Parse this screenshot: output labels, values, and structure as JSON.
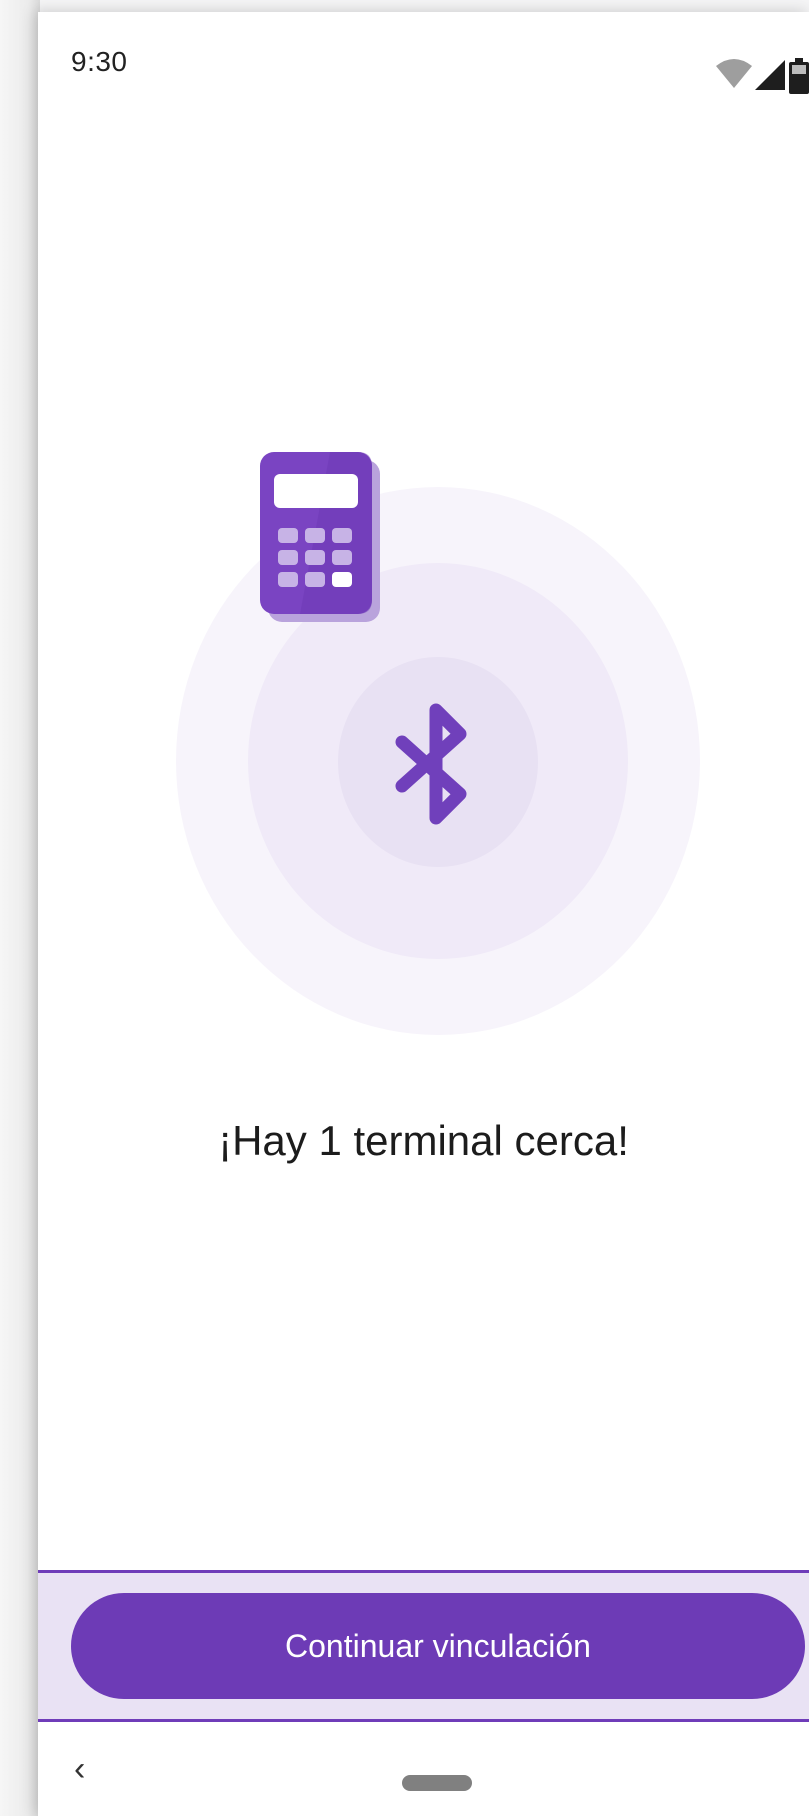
{
  "status_bar": {
    "time": "9:30",
    "icons": [
      "wifi-icon",
      "signal-icon",
      "battery-icon"
    ]
  },
  "illustration": {
    "icons": [
      "calculator-icon",
      "bluetooth-icon"
    ],
    "colors": {
      "accent": "#6d3bb6",
      "ring_outer": "#f7f4fb",
      "ring_middle": "#f0eaf8",
      "ring_inner": "#e8e1f3"
    }
  },
  "main": {
    "headline": "¡Hay 1 terminal cerca!"
  },
  "cta": {
    "label": "Continuar vinculación"
  },
  "nav_bar": {
    "back_glyph": "‹",
    "icons": [
      "back-icon",
      "home-pill-icon"
    ]
  }
}
